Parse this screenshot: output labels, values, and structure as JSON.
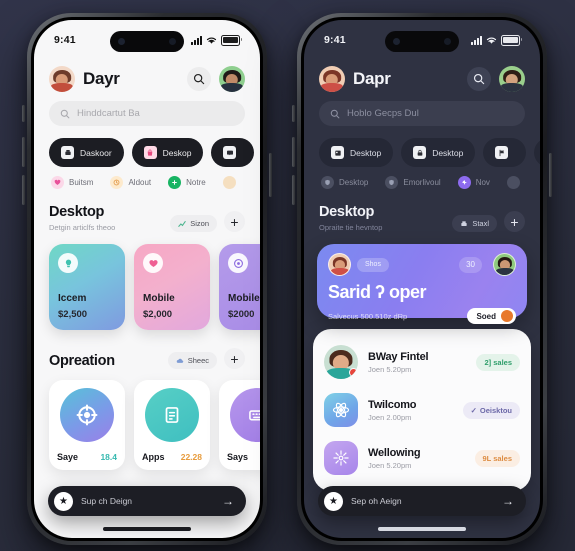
{
  "background_color": "#2e3142",
  "phone_left": {
    "theme": "light",
    "status": {
      "time": "9:41",
      "signal_icon": "cellular-bars-icon",
      "wifi_icon": "wifi-icon",
      "battery_icon": "battery-icon"
    },
    "header": {
      "title": "Dayr",
      "avatar_icon": "user-avatar",
      "search_icon": "search-icon",
      "profile_icon": "profile-avatar"
    },
    "search": {
      "placeholder": "Hinddcartut Bа",
      "icon": "search-icon"
    },
    "chips": [
      {
        "label": "Daskoor",
        "icon": "printer-icon"
      },
      {
        "label": "Deskop",
        "icon": "bag-icon"
      },
      {
        "label": "",
        "icon": "message-icon"
      },
      {
        "label": "",
        "icon": "grid-icon"
      }
    ],
    "chips2": [
      {
        "label": "Buitsm",
        "icon": "heart-pin-icon",
        "color": "#ef6ba8"
      },
      {
        "label": "Aldout",
        "icon": "clock-icon",
        "color": "#f0a14e"
      },
      {
        "label": "Notre",
        "icon": "plus-circle-icon",
        "color": "#1fb464"
      },
      {
        "label": "",
        "icon": "dot-icon",
        "color": "#e0a35d"
      }
    ],
    "section": {
      "title": "Desktop",
      "subtitle": "Detgin articlfs theoo",
      "pill_label": "Sizon",
      "pill_icon": "chart-icon",
      "add_label": "+"
    },
    "cards": [
      {
        "title": "Iccem",
        "value": "$2,500",
        "icon": "lightbulb-icon",
        "gradient": "linear-gradient(150deg,#6fd8c5 0%,#78c4dd 45%,#7f9ae0 100%)",
        "icon_color": "#4fc9b6"
      },
      {
        "title": "Mobile",
        "value": "$2,000",
        "icon": "heart-icon",
        "gradient": "linear-gradient(150deg,#f7a7c4 0%,#f3b0cd 45%,#e2a8dd 100%)",
        "icon_color": "#ef5f93"
      },
      {
        "title": "Mobile",
        "value": "$2000",
        "icon": "target-icon",
        "gradient": "linear-gradient(150deg,#b49bea 0%,#a78ae6 100%)",
        "icon_color": "#8c6bdf"
      }
    ],
    "section2": {
      "title": "Opreation",
      "pill_label": "Sheec",
      "pill_icon": "cloud-icon",
      "add_label": "+"
    },
    "opcards": [
      {
        "label": "Saye",
        "value": "18.4",
        "value_color": "#36b9b0",
        "icon": "lifebuoy-icon",
        "gradient": "linear-gradient(150deg,#57c2d8 0%,#7b9ae8 55%,#9b7fe8 100%)"
      },
      {
        "label": "Apps",
        "value": "22.28",
        "value_color": "#e79b3c",
        "icon": "clipboard-icon",
        "gradient": "linear-gradient(150deg,#57cfc6 0%,#3fbfc0 100%)"
      },
      {
        "label": "Says",
        "value": "",
        "value_color": "#9a7be3",
        "icon": "keyboard-icon",
        "gradient": "linear-gradient(150deg,#b697ec 0%,#a07ce6 100%)"
      }
    ],
    "bottombar": {
      "icon": "star-icon",
      "label": "Sup ch Deign",
      "arrow": "→"
    }
  },
  "phone_right": {
    "theme": "dark",
    "status": {
      "time": "9:41",
      "signal_icon": "cellular-bars-icon",
      "wifi_icon": "wifi-icon",
      "battery_icon": "battery-icon"
    },
    "header": {
      "title": "Dapr",
      "avatar_icon": "user-avatar",
      "search_icon": "search-icon",
      "profile_icon": "profile-avatar"
    },
    "search": {
      "placeholder": "Hoblo Gecps Dul",
      "icon": "search-icon"
    },
    "chips": [
      {
        "label": "Desktop",
        "icon": "calendar-icon"
      },
      {
        "label": "Desktop",
        "icon": "lock-icon"
      },
      {
        "label": "",
        "icon": "flag-icon"
      },
      {
        "label": "",
        "icon": "circle-icon"
      }
    ],
    "chips2": [
      {
        "label": "Desktop",
        "icon": "shield-icon",
        "color": "#565a6e"
      },
      {
        "label": "Emorlivoul",
        "icon": "shield-icon",
        "color": "#565a6e"
      },
      {
        "label": "Nov",
        "icon": "sparkle-icon",
        "color": "#8d6bef"
      },
      {
        "label": "",
        "icon": "dot-icon",
        "color": "#565a6e"
      }
    ],
    "section": {
      "title": "Desktop",
      "subtitle": "Opraite tie hevntop",
      "pill_label": "Staxl",
      "pill_icon": "printer-icon",
      "add_label": "+"
    },
    "hero": {
      "pill_label": "Shos",
      "count_badge": "30",
      "title": "Sarid ʔ oper",
      "subtitle": "Salvecus 500.510z dRp",
      "cta_label": "Soed",
      "avatar_left_icon": "user-avatar",
      "avatar_right_icon": "user-avatar"
    },
    "list": [
      {
        "name": "BWay Fintel",
        "sub": "Joen 5.20pm",
        "badge": "2] sales",
        "badge_bg": "#e4f3ea",
        "badge_color": "#2f9e6b",
        "avatar_type": "photo",
        "icon": "user-avatar",
        "has_dot": true
      },
      {
        "name": "Twilcomo",
        "sub": "Joen 2.00pm",
        "badge": "Oeisktou",
        "badge_bg": "#eceaf6",
        "badge_color": "#6d69a8",
        "badge_check": "✓",
        "avatar_type": "gradient",
        "icon": "atom-icon",
        "gradient": "linear-gradient(150deg,#7fd1e6 0%,#6fa5e8 60%,#7e8ee8 100%)"
      },
      {
        "name": "Wellowing",
        "sub": "Joen 5.20pm",
        "badge": "9L sales",
        "badge_bg": "#fbeee3",
        "badge_color": "#dd8c42",
        "avatar_type": "gradient",
        "icon": "flower-icon",
        "gradient": "linear-gradient(150deg,#c3a6ef 0%,#a785ea 100%)"
      }
    ],
    "bottombar": {
      "icon": "star-icon",
      "label": "Sep oh Aeign",
      "arrow": "→"
    }
  }
}
